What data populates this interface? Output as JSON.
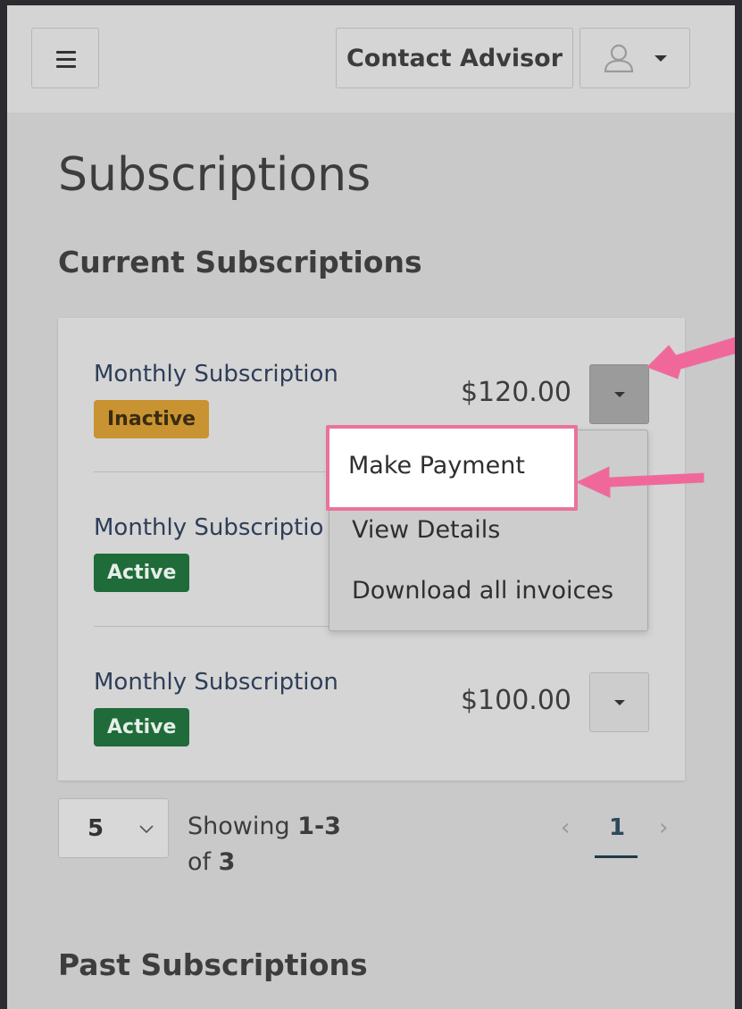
{
  "header": {
    "menu_icon": "hamburger-menu-icon",
    "contact_label": "Contact Advisor",
    "user_icon": "user-icon"
  },
  "page": {
    "title": "Subscriptions",
    "current_section": "Current Subscriptions",
    "past_section": "Past Subscriptions"
  },
  "subscriptions": [
    {
      "name": "Monthly Subscription",
      "status": "Inactive",
      "price": "$120.00"
    },
    {
      "name": "Monthly Subscriptio",
      "status": "Active",
      "price": ""
    },
    {
      "name": "Monthly Subscription",
      "status": "Active",
      "price": "$100.00"
    }
  ],
  "dropdown": {
    "items": [
      "Make Payment",
      "View Details",
      "Download all invoices"
    ]
  },
  "pagination": {
    "page_size": "5",
    "showing_prefix": "Showing ",
    "range": "1-3",
    "of_label": "of ",
    "total": "3",
    "prev": "‹",
    "current_page": "1",
    "next": "›"
  },
  "colors": {
    "annotation": "#f0679a",
    "inactive_badge": "#c89330",
    "active_badge": "#1f6b3a",
    "link": "#2e3e58"
  }
}
